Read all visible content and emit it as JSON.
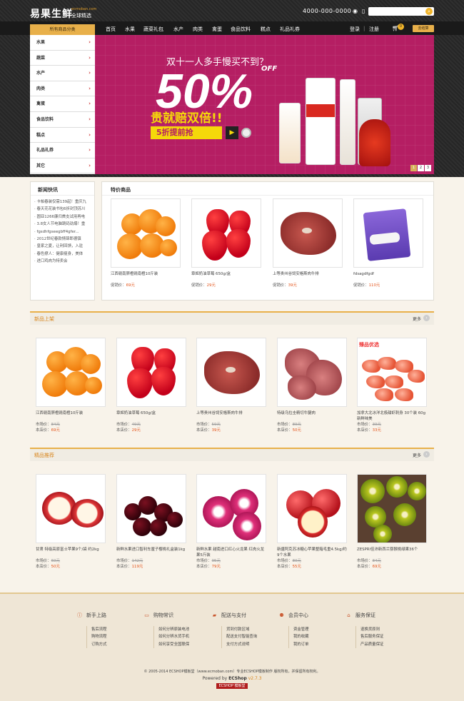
{
  "header": {
    "logo_text": "易果生鲜",
    "logo_en": "ecmoban.com",
    "logo_slogan": "全球精选",
    "phone": "4000-000-0000",
    "search_placeholder": ""
  },
  "nav": {
    "category_button": "所有商品分类",
    "items": [
      "首页",
      "水果",
      "蔬菜礼包",
      "水产",
      "肉类",
      "禽蛋",
      "食品饮料",
      "糕点",
      "礼品礼券"
    ],
    "login": "登录",
    "register": "注册",
    "cart_count": "0",
    "checkout": "去结算"
  },
  "categories": [
    "水果",
    "蔬菜",
    "水产",
    "肉类",
    "禽蛋",
    "食品饮料",
    "糕点",
    "礼品礼券",
    "其它"
  ],
  "banner": {
    "subtitle": "双十一人多手慢买不到？",
    "percent": "50%",
    "off": "OFF",
    "headline": "贵就赔双倍!!",
    "cta": "5折提前抢",
    "pages": [
      "1",
      "2",
      "3"
    ],
    "active_page": 1
  },
  "news": {
    "title": "新闻快讯",
    "items": [
      "卡帕春装仅需139起！重庆九",
      "春天花花装书包6折封顶苏川",
      "圆亚1266廉归首支试用再电",
      "3.8女人节电脑跳码劲爆！重",
      "fgsdhfgseegbff4gfer...",
      "2012世纪春款情锦郎德镇",
      "皇家之夏，让利回馈，入驻",
      "春色撩人：健康瘦身，美体",
      "进口鸡肉为特卖会"
    ]
  },
  "special": {
    "title": "特价商品",
    "price_label": "促销价：",
    "products": [
      {
        "name": "江西赣南脐橙赣南橙10斤装",
        "price": "69元"
      },
      {
        "name": "章姬奶油草莓 650g/盒",
        "price": "29元"
      },
      {
        "name": "上等贵州谷饲安格斯肉牛排",
        "price": "39元"
      },
      {
        "name": "fdsagdfgdf",
        "price": "110元"
      }
    ]
  },
  "new_arrivals": {
    "title": "新品上架",
    "more": "更多",
    "market_label": "市场价：",
    "shop_label": "本店价：",
    "products": [
      {
        "name": "江西赣南脐橙赣南橙10斤装",
        "market": "84元",
        "price": "69元"
      },
      {
        "name": "章姬奶油草莓 650g/盒",
        "market": "49元",
        "price": "29元"
      },
      {
        "name": "上等贵州谷饲安格斯肉牛排",
        "market": "59元",
        "price": "39元"
      },
      {
        "name": "特级乌拉圭精切牛腱肉",
        "market": "89元",
        "price": "50元"
      },
      {
        "name": "加拿大北冰洋北极甜虾刺身 30个装 60g 新鲜味美",
        "market": "39元",
        "price": "33元"
      }
    ],
    "tag": "臻品优选"
  },
  "recommended": {
    "title": "精品推荐",
    "more": "更多",
    "market_label": "市场价：",
    "shop_label": "本店价：",
    "products": [
      {
        "name": "甘肃 特级高原富士苹果9个/袋 约2kg",
        "market": "60元",
        "price": "50元"
      },
      {
        "name": "新鲜水果进口智利车厘子樱桃礼盒装1kg",
        "market": "142元",
        "price": "119元"
      },
      {
        "name": "新鲜水果 越南进口红心火龙果 红肉火龙果5斤装",
        "market": "95元",
        "price": "79元"
      },
      {
        "name": "新疆阿克苏冰糖心苹果整箱毛重4.5kg/约9个水果",
        "market": "80元",
        "price": "55元"
      },
      {
        "name": "ZESPRI佳沛新西兰猕猴桃绿果36个",
        "market": "84元",
        "price": "69元"
      }
    ]
  },
  "footer": {
    "columns": [
      {
        "title": "新手上路",
        "icon": "info-icon",
        "links": [
          "售后流程",
          "购物流程",
          "订购方式"
        ]
      },
      {
        "title": "购物常识",
        "icon": "card-icon",
        "links": [
          "如何分辨原装电池",
          "如何分辨水货手机",
          "如何享受全国联保"
        ]
      },
      {
        "title": "配送与支付",
        "icon": "truck-icon",
        "links": [
          "货到付款区域",
          "配送支付智能查询",
          "支付方式说明"
        ]
      },
      {
        "title": "会员中心",
        "icon": "members-icon",
        "links": [
          "资金管理",
          "我的收藏",
          "我的订单"
        ]
      },
      {
        "title": "服务保证",
        "icon": "home-icon",
        "links": [
          "退换货原则",
          "售后服务保证",
          "产品质量保证"
        ]
      }
    ],
    "copyright": "© 2005-2014 ECSHOP模板堂（www.ecmoban.com）专业ECSHOP模板制作 版权所有，并保留所有权利。",
    "powered_by": "Powered by",
    "powered_brand": "ECShop",
    "powered_version": "v2.7.3",
    "badge": "ECSHOP 模板堂"
  },
  "colors": {
    "accent": "#e8b04a",
    "price": "#e4551b",
    "banner": "#b51e63",
    "footer_bg": "#efe6d6"
  }
}
